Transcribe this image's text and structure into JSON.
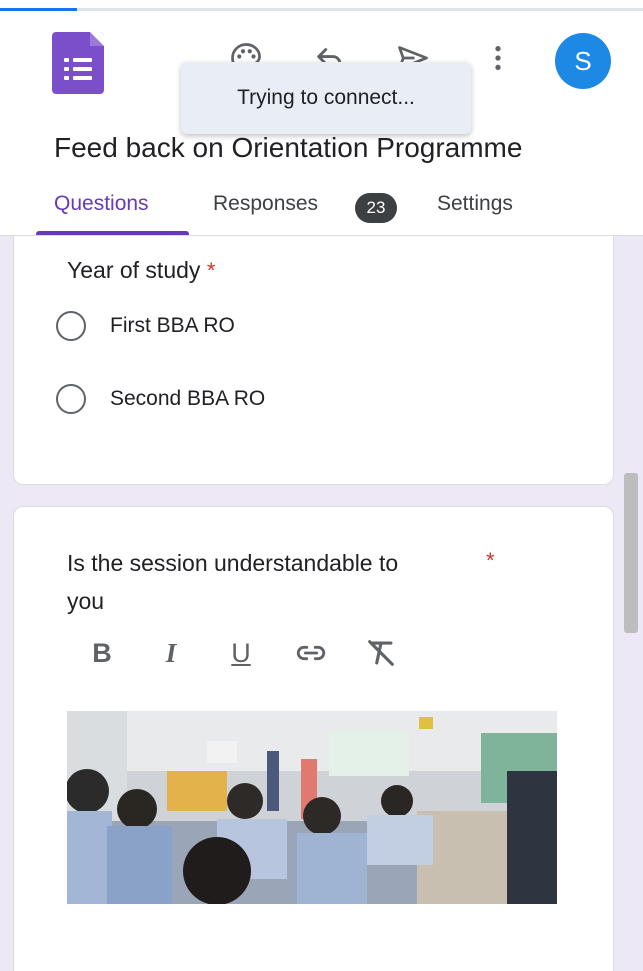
{
  "load_progress": 0.12,
  "toolbar": {
    "app_icon": "forms-list-icon",
    "palette_icon": "palette-icon",
    "undo_icon": "undo-icon",
    "send_icon": "send-icon",
    "more_icon": "more-vert-icon"
  },
  "user": {
    "avatar_letter": "S"
  },
  "toast": {
    "text": "Trying to connect..."
  },
  "form": {
    "title": "Feed back on Orientation Programme"
  },
  "tabs": [
    {
      "label": "Questions",
      "active": true
    },
    {
      "label": "Responses",
      "badge": "23"
    },
    {
      "label": "Settings"
    }
  ],
  "questions": [
    {
      "title": "Year of study",
      "required_mark": "*",
      "options": [
        "First BBA RO",
        "Second BBA RO"
      ]
    },
    {
      "title_line1": "Is the session understandable to",
      "title_line2": "you",
      "required_mark": "*",
      "format_buttons": [
        "B",
        "I",
        "U",
        "link-icon",
        "clear-format-icon"
      ],
      "image": "classroom-session-photo"
    }
  ],
  "colors": {
    "accent": "#673ab7",
    "app_icon": "#7b4fc9",
    "avatar": "#1e88e5",
    "required": "#d93025",
    "form_background": "#ece8f5",
    "progress": "#1a73e8"
  }
}
